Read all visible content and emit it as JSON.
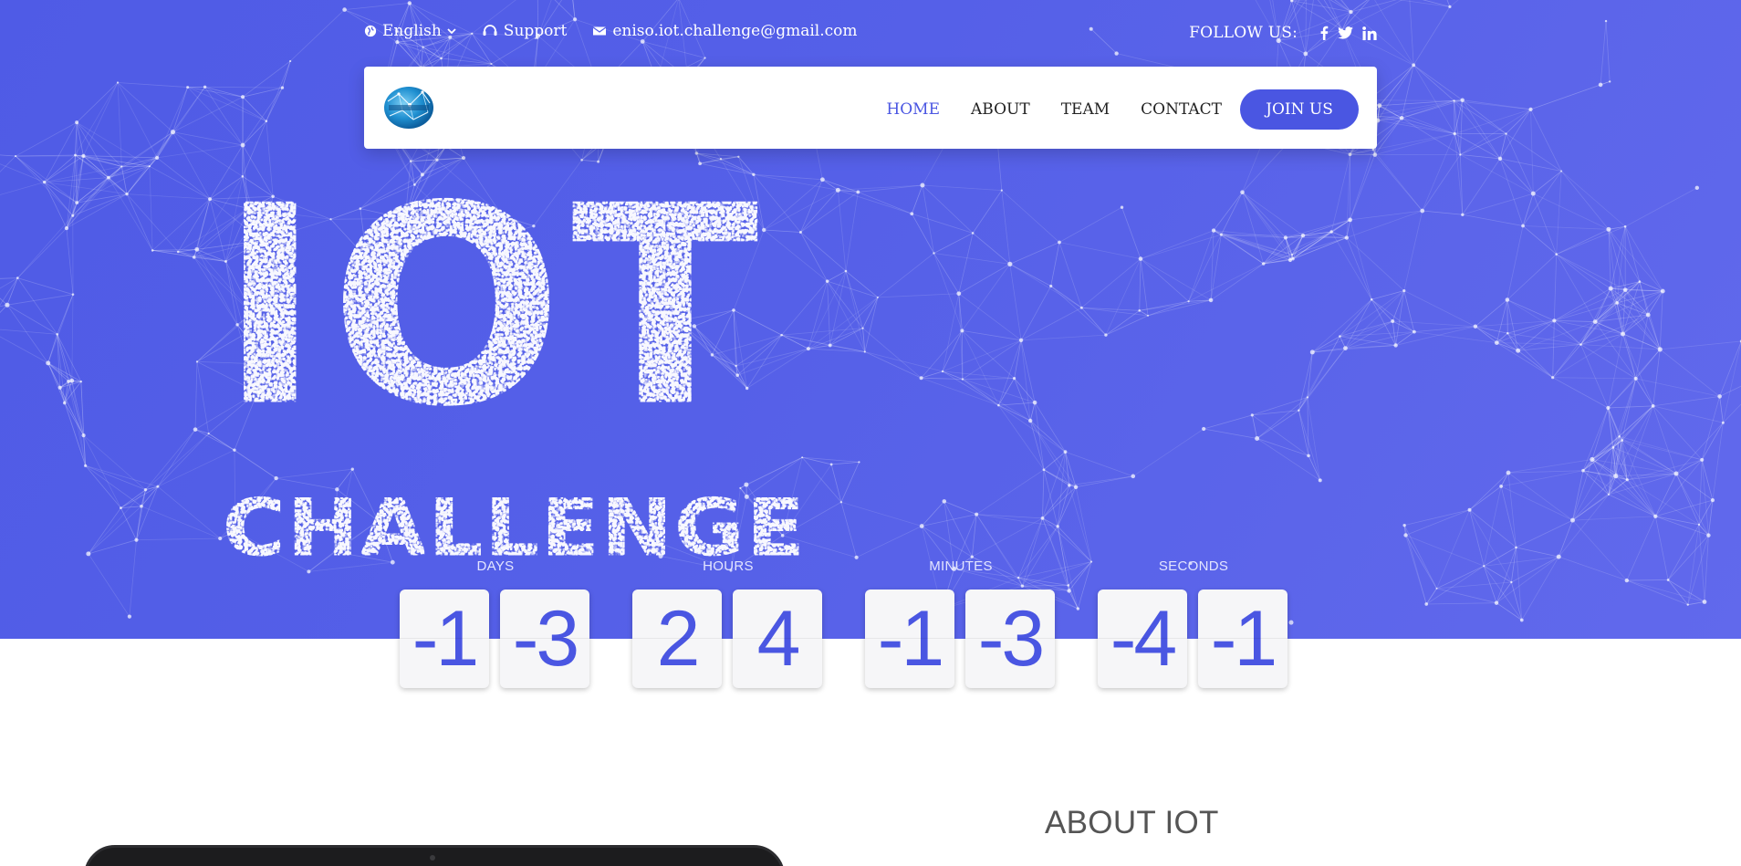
{
  "topbar": {
    "language": "English",
    "support": "Support",
    "email": "eniso.iot.challenge@gmail.com",
    "follow_label": "FOLLOW US:",
    "socials": [
      "facebook-icon",
      "twitter-icon",
      "linkedin-icon"
    ]
  },
  "navbar": {
    "logo_alt": "Logo",
    "links": [
      {
        "label": "HOME",
        "active": true
      },
      {
        "label": "ABOUT",
        "active": false
      },
      {
        "label": "TEAM",
        "active": false
      },
      {
        "label": "CONTACT",
        "active": false
      }
    ],
    "join_label": "JOIN US"
  },
  "hero": {
    "title_line1": "IOT",
    "title_line2": "CHALLENGE"
  },
  "countdown": {
    "days": {
      "label": "DAYS",
      "d1": "-1",
      "d2": "-3"
    },
    "hours": {
      "label": "HOURS",
      "d1": "2",
      "d2": "4"
    },
    "minutes": {
      "label": "MINUTES",
      "d1": "-1",
      "d2": "-3"
    },
    "seconds": {
      "label": "SECONDS",
      "d1": "-4",
      "d2": "-1"
    }
  },
  "about": {
    "title": "ABOUT IOT"
  },
  "colors": {
    "accent": "#4a56e2",
    "hero_bg": "#5560e8",
    "white": "#ffffff"
  }
}
